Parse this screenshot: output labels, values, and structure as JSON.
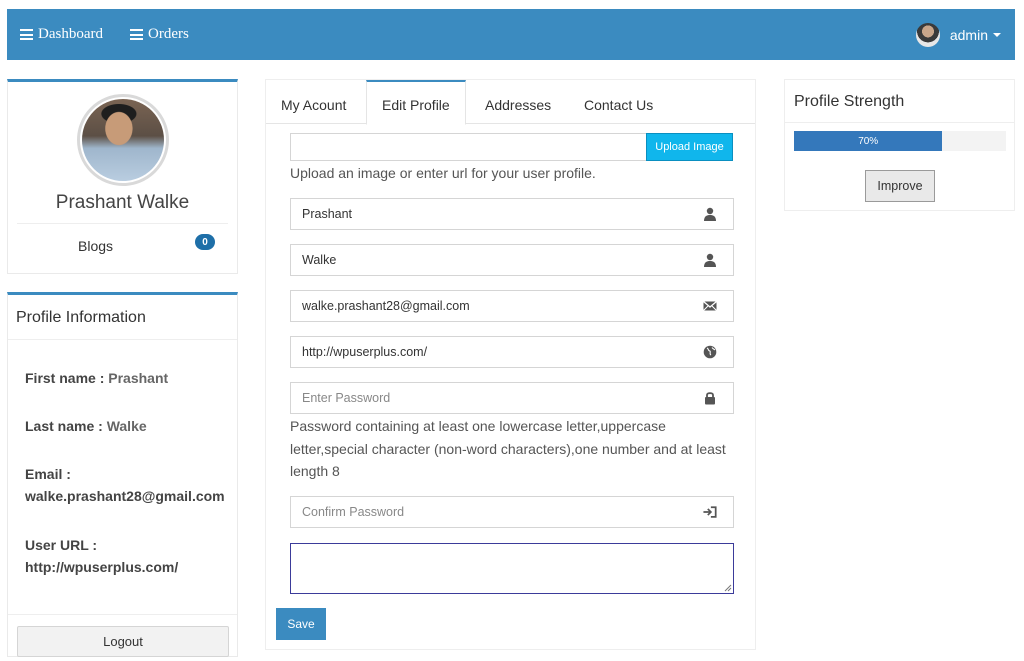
{
  "navbar": {
    "dashboard_label": "Dashboard",
    "orders_label": "Orders",
    "user_label": "admin",
    "bg_color": "#3b8bc0"
  },
  "profile": {
    "name": "Prashant Walke",
    "blogs_label": "Blogs",
    "blogs_count": "0"
  },
  "info": {
    "title": "Profile Information",
    "first_name_label": "First name :",
    "first_name": "Prashant",
    "last_name_label": "Last name :",
    "last_name": "Walke",
    "email_label": "Email :",
    "email": "walke.prashant28@gmail.com",
    "url_label": "User URL :",
    "url": "http://wpuserplus.com/",
    "logout_label": "Logout"
  },
  "tabs": [
    {
      "label": "My Acount"
    },
    {
      "label": "Edit Profile"
    },
    {
      "label": "Addresses"
    },
    {
      "label": "Contact Us"
    }
  ],
  "form": {
    "upload_button": "Upload Image",
    "upload_help": "Upload an image or enter url for your user profile.",
    "first_name_value": "Prashant",
    "last_name_value": "Walke",
    "email_value": "walke.prashant28@gmail.com",
    "url_value": "http://wpuserplus.com/",
    "password_placeholder": "Enter Password",
    "password_help": "Password containing at least one lowercase letter,uppercase letter,special character (non-word characters),one number and at least length 8",
    "confirm_placeholder": "Confirm Password",
    "save_label": "Save",
    "icons": [
      "user-icon",
      "user-icon",
      "envelope-icon",
      "globe-icon",
      "lock-icon",
      "sign-in-icon"
    ]
  },
  "strength": {
    "title": "Profile Strength",
    "percent": 70,
    "percent_label": "70%",
    "improve_label": "Improve",
    "bar_color": "#3478bb"
  }
}
